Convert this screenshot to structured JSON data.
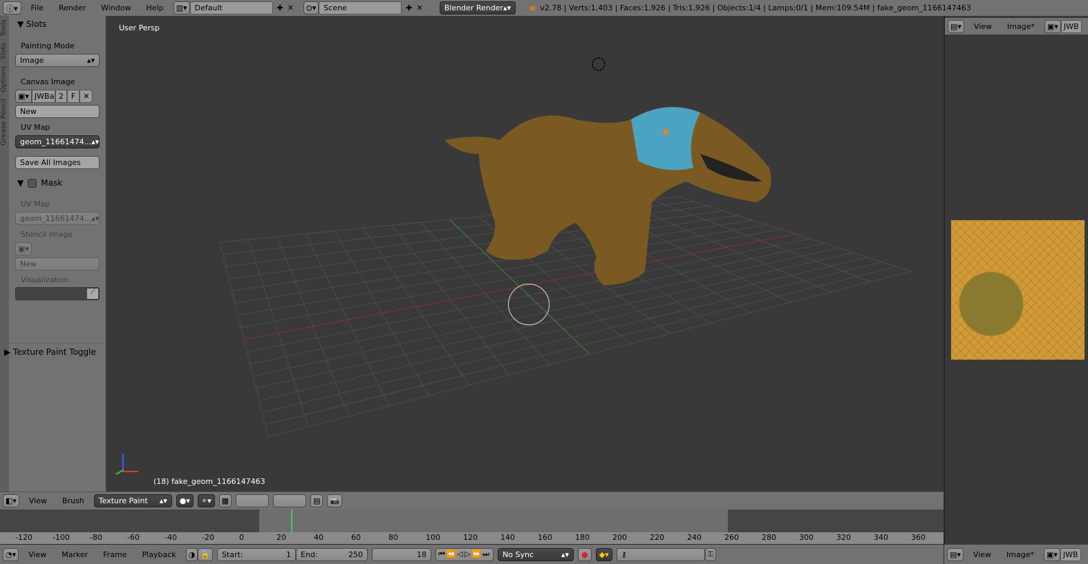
{
  "topbar": {
    "menus": [
      "File",
      "Render",
      "Window",
      "Help"
    ],
    "layout": "Default",
    "scene": "Scene",
    "engine": "Blender Render",
    "stats": "v2.78 | Verts:1,403 | Faces:1,926 | Tris:1,926 | Objects:1/4 | Lamps:0/1 | Mem:109.54M | fake_geom_1166147463"
  },
  "tabs": [
    "Tools",
    "Slots",
    "Options",
    "Grease Pencil"
  ],
  "slots": {
    "title": "Slots",
    "painting_mode_label": "Painting Mode",
    "painting_mode": "Image",
    "canvas_label": "Canvas Image",
    "canvas_name": "JWBa",
    "canvas_users": "2",
    "fake": "F",
    "new": "New",
    "uv_label": "UV Map",
    "uv_value": "geom_11661474...",
    "save_all": "Save All Images"
  },
  "mask": {
    "title": "Mask",
    "uv_label": "UV Map",
    "uv_value": "geom_11661474...",
    "stencil_label": "Stencil Image",
    "new": "New",
    "vis_label": "Visualization"
  },
  "toggle": {
    "title": "Texture Paint Toggle"
  },
  "viewport": {
    "view_name": "User Persp",
    "object_label": "(18) fake_geom_1166147463"
  },
  "header3d": {
    "menus": [
      "View",
      "Brush"
    ],
    "mode": "Texture Paint"
  },
  "timeline": {
    "ticks": [
      "-120",
      "-100",
      "-80",
      "-60",
      "-40",
      "-20",
      "0",
      "20",
      "40",
      "60",
      "80",
      "100",
      "120",
      "140",
      "160",
      "180",
      "200",
      "220",
      "240",
      "260",
      "280",
      "300",
      "320",
      "340",
      "360"
    ],
    "current_frame": 18,
    "menus": [
      "View",
      "Marker",
      "Frame",
      "Playback"
    ],
    "start_label": "Start:",
    "start": "1",
    "end_label": "End:",
    "end": "250",
    "frame": "18",
    "sync": "No Sync"
  },
  "image_editor": {
    "menus": [
      "View",
      "Image*"
    ],
    "image_name": "JWB"
  }
}
